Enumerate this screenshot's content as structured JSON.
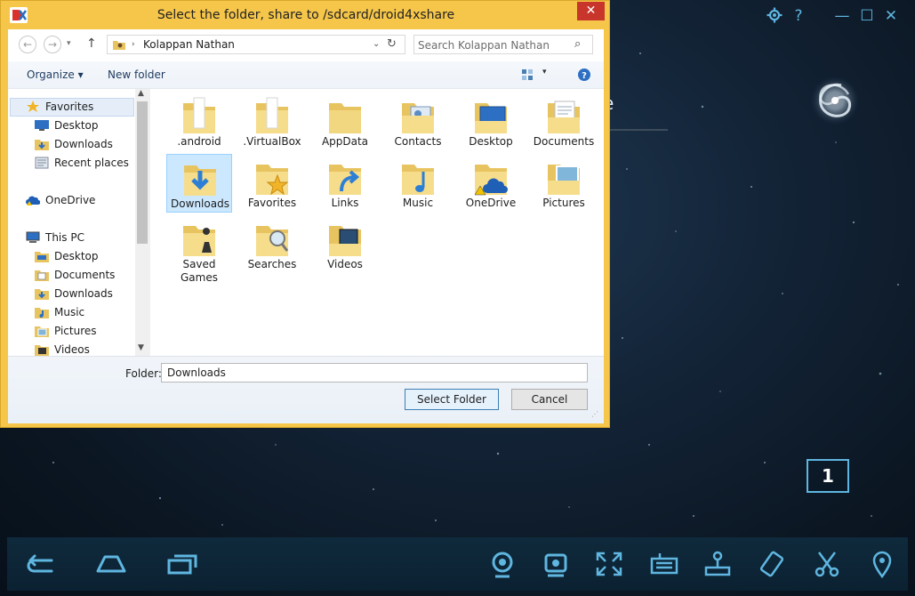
{
  "dialog": {
    "title": "Select the folder, share to /sdcard/droid4xshare",
    "close_glyph": "✕",
    "address_path": "Kolappan Nathan",
    "search_placeholder": "Search Kolappan Nathan",
    "toolbar": {
      "organize": "Organize ▾",
      "new_folder": "New folder"
    },
    "nav": {
      "favorites": "Favorites",
      "desktop": "Desktop",
      "downloads": "Downloads",
      "recent": "Recent places",
      "onedrive": "OneDrive",
      "thispc": "This PC",
      "pc_desktop": "Desktop",
      "pc_documents": "Documents",
      "pc_downloads": "Downloads",
      "pc_music": "Music",
      "pc_pictures": "Pictures",
      "pc_videos": "Videos"
    },
    "folders": [
      ".android",
      ".VirtualBox",
      "AppData",
      "Contacts",
      "Desktop",
      "Documents",
      "Downloads",
      "Favorites",
      "Links",
      "Music",
      "OneDrive",
      "Pictures",
      "Saved Games",
      "Searches",
      "Videos"
    ],
    "selected_folder": "Downloads",
    "folder_label": "Folder:",
    "folder_value": "Downloads",
    "select_button": "Select Folder",
    "cancel_button": "Cancel"
  },
  "emulator": {
    "settings_icon": "gear-icon",
    "help_glyph": "?",
    "minimize_glyph": "—",
    "maximize_glyph": "☐",
    "close_glyph": "✕",
    "page_number": "1",
    "partial_text": "e",
    "accent_color": "#5fb6e0"
  }
}
